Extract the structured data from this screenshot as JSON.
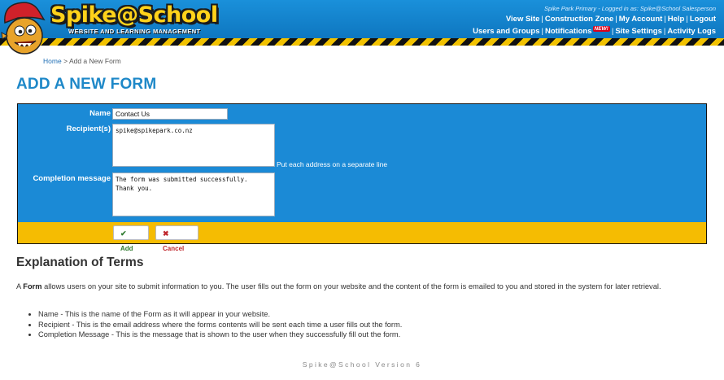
{
  "header": {
    "logo_text": "Spike@School",
    "logo_subtitle": "WEBSITE AND LEARNING MANAGEMENT",
    "logged_in": "Spike Park Primary - Logged in as: Spike@School Salesperson",
    "nav_row1": [
      "View Site",
      "Construction Zone",
      "My Account",
      "Help",
      "Logout"
    ],
    "nav_row2": [
      "Users and Groups",
      "Notifications",
      "Site Settings",
      "Activity Logs"
    ],
    "new_badge": "NEW!"
  },
  "breadcrumb": {
    "home": "Home",
    "separator": ">",
    "current": "Add a New Form"
  },
  "page_title": "ADD A NEW FORM",
  "form": {
    "name_label": "Name",
    "name_value": "Contact Us",
    "recipients_label": "Recipient(s)",
    "recipients_value": "spike@spikepark.co.nz",
    "recipients_hint": "Put each address on a separate line",
    "completion_label": "Completion message",
    "completion_value": "The form was submitted successfully.\nThank you.",
    "add_label": "Add",
    "cancel_label": "Cancel"
  },
  "explanation": {
    "heading": "Explanation of Terms",
    "intro_prefix": "A ",
    "intro_term": "Form",
    "intro_rest": " allows users on your site to submit information to you. The user fills out the form on your website and the content of the form is emailed to you and stored in the system for later retrieval.",
    "terms": [
      "Name - This is the name of the Form as it will appear in your website.",
      "Recipient - This is the email address where the forms contents will be sent each time a user fills out the form.",
      "Completion Message - This is the message that is shown to the user when they successfully fill out the form."
    ]
  },
  "footer": "Spike@School Version 6",
  "colors": {
    "header_blue": "#1589d6",
    "form_blue": "#1b8ad6",
    "action_yellow": "#f5bc02",
    "title_blue": "#1e88c8"
  }
}
